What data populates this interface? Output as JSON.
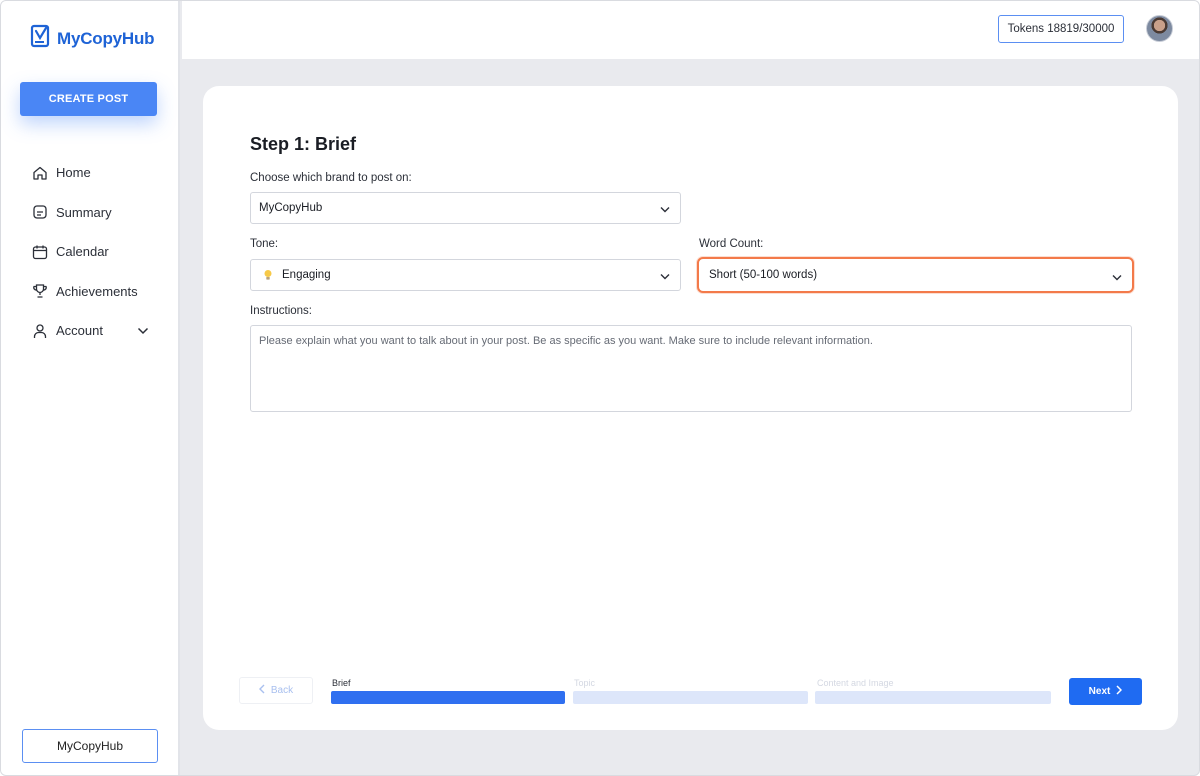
{
  "app": {
    "name": "MyCopyHub"
  },
  "sidebar": {
    "create_label": "CREATE POST",
    "items": [
      {
        "label": "Home",
        "icon": "home-icon"
      },
      {
        "label": "Summary",
        "icon": "document-icon"
      },
      {
        "label": "Calendar",
        "icon": "calendar-icon"
      },
      {
        "label": "Achievements",
        "icon": "trophy-icon"
      },
      {
        "label": "Account",
        "icon": "user-icon"
      }
    ],
    "brand_button": "MyCopyHub"
  },
  "header": {
    "tokens": "Tokens 18819/30000"
  },
  "form": {
    "title": "Step 1: Brief",
    "brand": {
      "label": "Choose which brand to post on:",
      "value": "MyCopyHub"
    },
    "tone": {
      "label": "Tone:",
      "value": "Engaging",
      "icon": "lightbulb-icon"
    },
    "word_count": {
      "label": "Word Count:",
      "value": "Short (50-100 words)"
    },
    "instructions": {
      "label": "Instructions:",
      "placeholder": "Please explain what you want to talk about in your post. Be as specific as you want. Make sure to include relevant information."
    }
  },
  "footer": {
    "back_label": "Back",
    "next_label": "Next",
    "steps": [
      {
        "label": "Brief",
        "active": true
      },
      {
        "label": "Topic",
        "active": false
      },
      {
        "label": "Content and Image",
        "active": false
      }
    ]
  },
  "colors": {
    "accent": "#1f6bf2",
    "highlight": "#f37a4a",
    "background": "#e9eaee"
  }
}
